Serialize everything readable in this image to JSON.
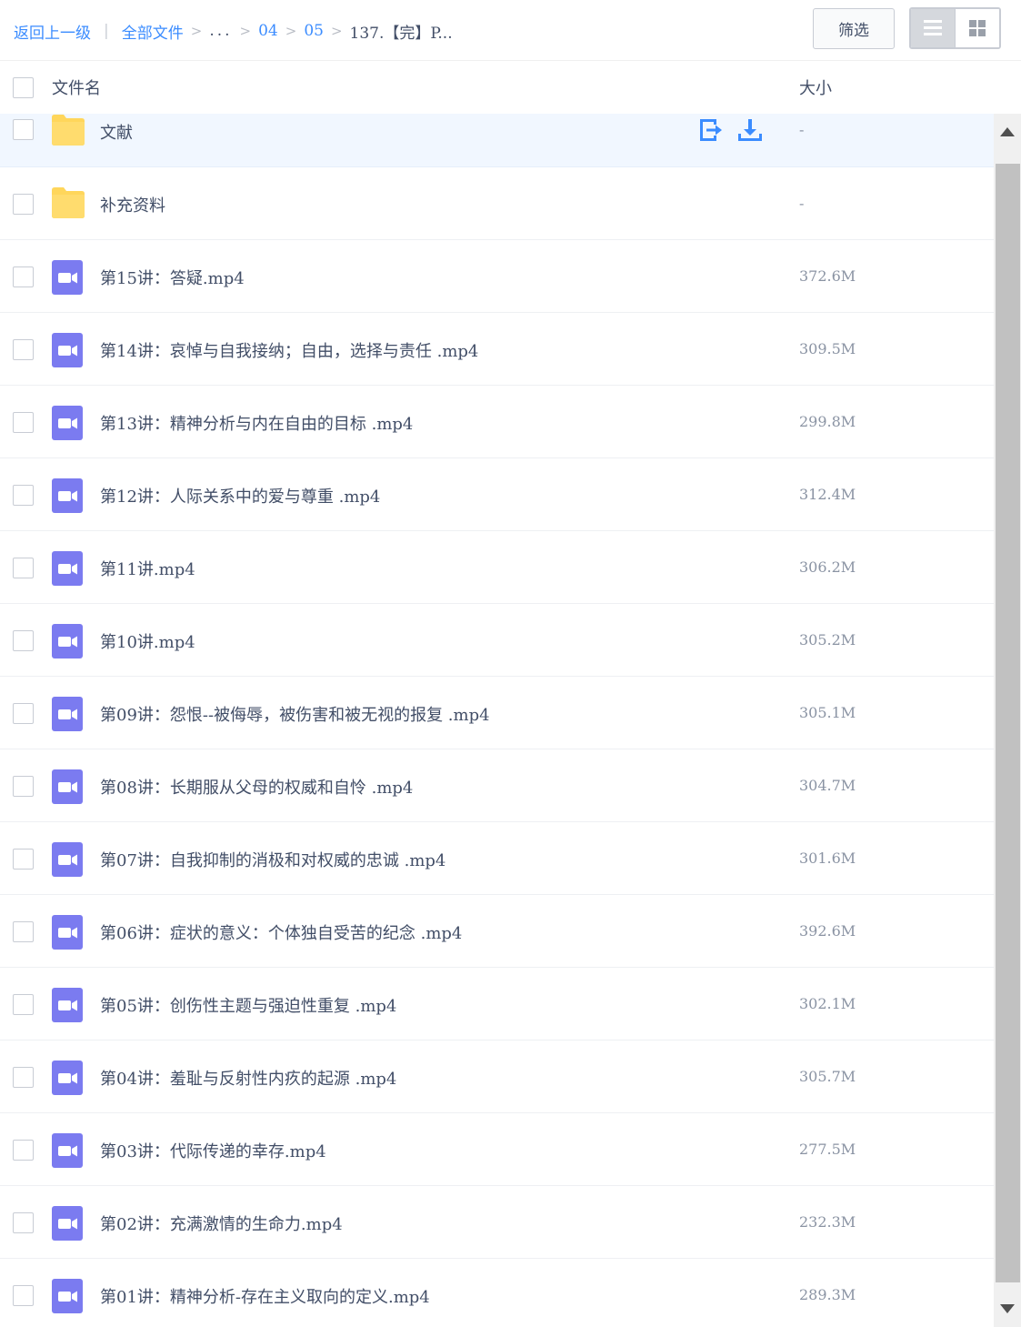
{
  "breadcrumb": {
    "back_label": "返回上一级",
    "root_label": "全部文件",
    "ellipsis": "...",
    "path": [
      "04",
      "05"
    ],
    "current": "137.【完】P..."
  },
  "toolbar": {
    "filter_label": "筛选"
  },
  "header": {
    "name_col": "文件名",
    "size_col": "大小"
  },
  "files": [
    {
      "name": "文献",
      "size": "-",
      "type": "folder"
    },
    {
      "name": "补充资料",
      "size": "-",
      "type": "folder"
    },
    {
      "name": "第15讲：答疑.mp4",
      "size": "372.6M",
      "type": "video"
    },
    {
      "name": "第14讲：哀悼与自我接纳；自由，选择与责任 .mp4",
      "size": "309.5M",
      "type": "video"
    },
    {
      "name": "第13讲：精神分析与内在自由的目标 .mp4",
      "size": "299.8M",
      "type": "video"
    },
    {
      "name": "第12讲：人际关系中的爱与尊重 .mp4",
      "size": "312.4M",
      "type": "video"
    },
    {
      "name": "第11讲.mp4",
      "size": "306.2M",
      "type": "video"
    },
    {
      "name": "第10讲.mp4",
      "size": "305.2M",
      "type": "video"
    },
    {
      "name": "第09讲：怨恨--被侮辱，被伤害和被无视的报复 .mp4",
      "size": "305.1M",
      "type": "video"
    },
    {
      "name": "第08讲：长期服从父母的权威和自怜 .mp4",
      "size": "304.7M",
      "type": "video"
    },
    {
      "name": "第07讲：自我抑制的消极和对权威的忠诚 .mp4",
      "size": "301.6M",
      "type": "video"
    },
    {
      "name": "第06讲：症状的意义：个体独自受苦的纪念 .mp4",
      "size": "392.6M",
      "type": "video"
    },
    {
      "name": "第05讲：创伤性主题与强迫性重复 .mp4",
      "size": "302.1M",
      "type": "video"
    },
    {
      "name": "第04讲：羞耻与反射性内疚的起源 .mp4",
      "size": "305.7M",
      "type": "video"
    },
    {
      "name": "第03讲：代际传递的幸存.mp4",
      "size": "277.5M",
      "type": "video"
    },
    {
      "name": "第02讲：充满激情的生命力.mp4",
      "size": "232.3M",
      "type": "video"
    },
    {
      "name": "第01讲：精神分析-存在主义取向的定义.mp4",
      "size": "289.3M",
      "type": "video"
    }
  ],
  "colors": {
    "link": "#3b8cff",
    "text": "#424e67",
    "folder": "#ffd65b",
    "video": "#7b7bf0",
    "hover_row": "#f1f7ff"
  },
  "icons": {
    "folder": "folder-icon",
    "video": "video-file-icon",
    "save": "save-to-drive-icon",
    "download": "download-icon",
    "list_view": "list-view-icon",
    "grid_view": "grid-view-icon"
  }
}
